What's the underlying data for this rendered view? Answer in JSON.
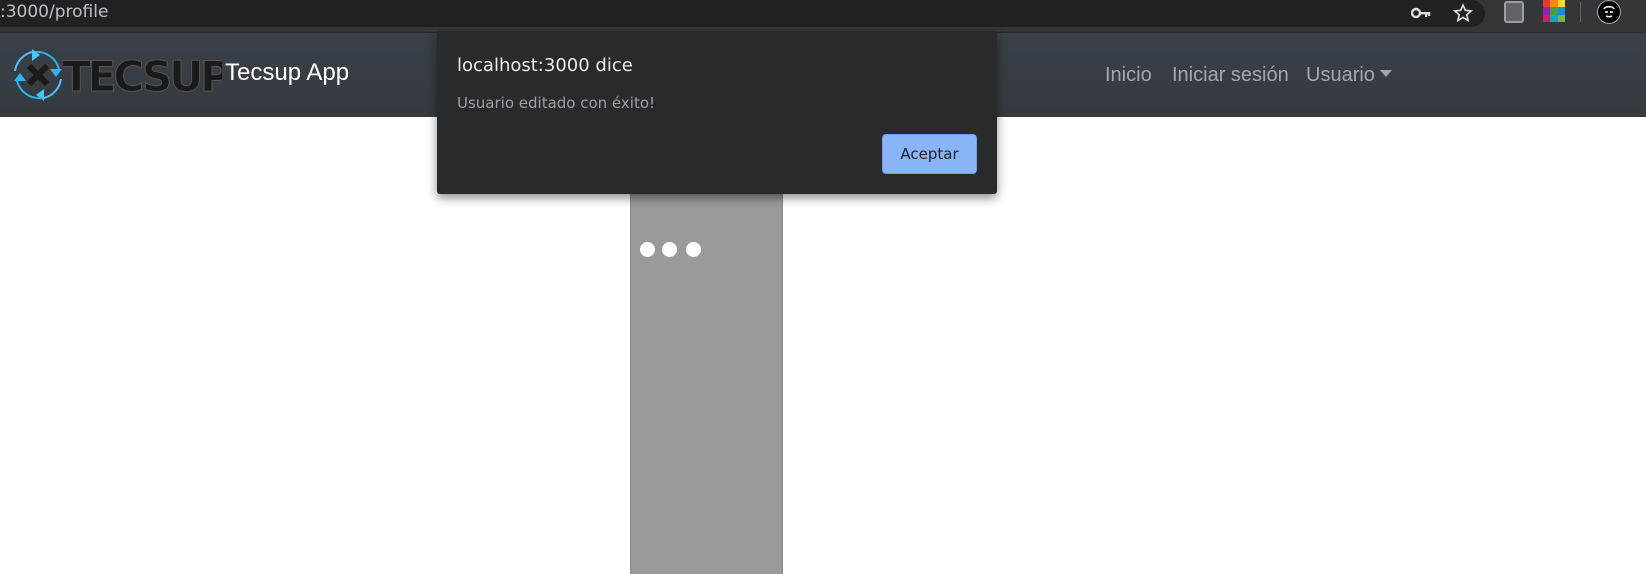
{
  "browser": {
    "url": ":3000/profile",
    "icons": [
      "key-icon",
      "star-icon",
      "extension-icon",
      "color-grid-extension-icon",
      "profile-avatar-icon"
    ]
  },
  "navbar": {
    "brand_logo_text": "TECSUP",
    "brand": "Tecsup App",
    "links": {
      "home": "Inicio",
      "login": "Iniciar sesión",
      "user": "Usuario"
    }
  },
  "dialog": {
    "title": "localhost:3000 dice",
    "message": "Usuario editado con éxito!",
    "accept_label": "Aceptar",
    "accent_color": "#8ab4f8"
  },
  "colors": {
    "navbar_bg": "#343a40",
    "column_bg": "#9a9a9a",
    "dialog_bg": "#292a2d"
  }
}
